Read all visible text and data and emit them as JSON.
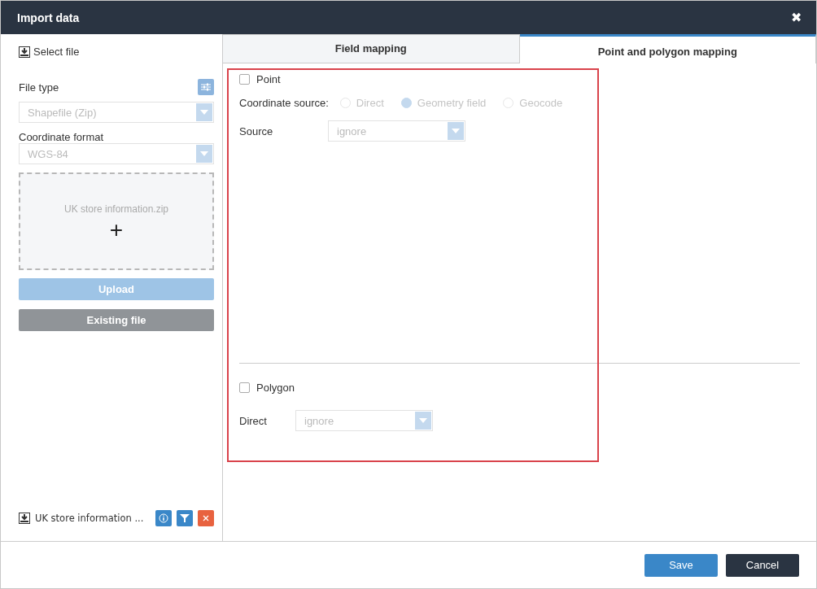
{
  "window": {
    "title": "Import data",
    "close": "✖"
  },
  "sidebar": {
    "select_file": "Select file",
    "file_type": {
      "label": "File type",
      "value": "Shapefile (Zip)"
    },
    "coordinate_format": {
      "label": "Coordinate format",
      "value": "WGS-84"
    },
    "drop_zone": {
      "file_name": "UK store information.zip",
      "add": "+"
    },
    "upload_button": "Upload",
    "existing_button": "Existing file",
    "file_item": {
      "name": "UK store information ..."
    }
  },
  "tabs": [
    {
      "label": "Field mapping",
      "selected": false
    },
    {
      "label": "Point and polygon mapping",
      "selected": true
    }
  ],
  "point": {
    "label": "Point",
    "checked": false,
    "coordinate_source_label": "Coordinate source:",
    "options": [
      {
        "label": "Direct",
        "selected": false
      },
      {
        "label": "Geometry field",
        "selected": true
      },
      {
        "label": "Geocode",
        "selected": false
      }
    ],
    "source_label": "Source",
    "source_value": "ignore"
  },
  "polygon": {
    "label": "Polygon",
    "checked": false,
    "direct_label": "Direct",
    "direct_value": "ignore"
  },
  "footer": {
    "buttons": [
      {
        "label": "Save",
        "kind": "primary"
      },
      {
        "label": "Cancel",
        "kind": "dark"
      }
    ]
  }
}
